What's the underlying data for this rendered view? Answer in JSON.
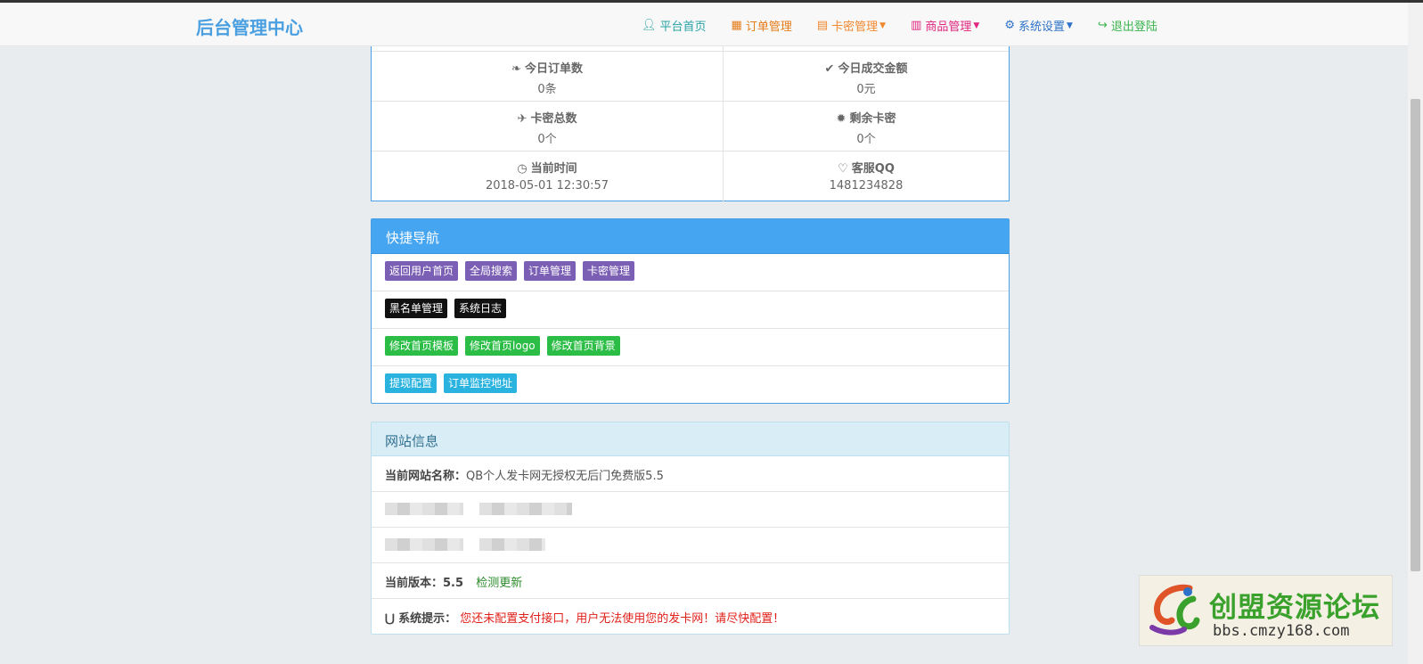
{
  "navbar": {
    "brand": "后台管理中心",
    "items": [
      {
        "label": "平台首页",
        "icon": "user-icon",
        "color": "#27a3a4",
        "dropdown": false
      },
      {
        "label": "订单管理",
        "icon": "calendar-icon",
        "color": "#e57c1a",
        "dropdown": false
      },
      {
        "label": "卡密管理",
        "icon": "list-alt-icon",
        "color": "#f0882e",
        "dropdown": true
      },
      {
        "label": "商品管理",
        "icon": "book-icon",
        "color": "#e0247f",
        "dropdown": true
      },
      {
        "label": "系统设置",
        "icon": "cog-icon",
        "color": "#2e73c9",
        "dropdown": true
      },
      {
        "label": "退出登陆",
        "icon": "logout-icon",
        "color": "#3bb34d",
        "dropdown": false
      }
    ]
  },
  "stats": {
    "today_orders": {
      "label": "今日订单数",
      "value": "0条",
      "icon": "leaf-icon"
    },
    "today_amount": {
      "label": "今日成交金额",
      "value": "0元",
      "icon": "check-icon"
    },
    "card_total": {
      "label": "卡密总数",
      "value": "0个",
      "icon": "plane-icon"
    },
    "card_remaining": {
      "label": "剩余卡密",
      "value": "0个",
      "icon": "asterisk-icon"
    },
    "current_time": {
      "label": "当前时间",
      "value": "2018-05-01 12:30:57",
      "icon": "clock-icon"
    },
    "service_qq": {
      "label": "客服QQ",
      "value": "1481234828",
      "icon": "heart-icon"
    }
  },
  "quick_nav": {
    "title": "快捷导航",
    "rows": [
      [
        "返回用户首页",
        "全局搜索",
        "订单管理",
        "卡密管理"
      ],
      [
        "黑名单管理",
        "系统日志"
      ],
      [
        "修改首页模板",
        "修改首页logo",
        "修改首页背景"
      ],
      [
        "提现配置",
        "订单监控地址"
      ]
    ],
    "row_colors": [
      "#7b5fb5",
      "#111111",
      "#2bbd45",
      "#2bb3e0"
    ]
  },
  "site_info": {
    "title": "网站信息",
    "site_name_label": "当前网站名称：",
    "site_name_value": "QB个人发卡网无授权无后门免费版5.5",
    "version_label": "当前版本：",
    "version_value": "5.5",
    "check_update": "检测更新",
    "system_tip_label": "系统提示：",
    "system_tip_value": "您还未配置支付接口，用户无法使用您的发卡网！请尽快配置！"
  },
  "watermark": {
    "title": "创盟资源论坛",
    "url": "bbs.cmzy168.com"
  }
}
